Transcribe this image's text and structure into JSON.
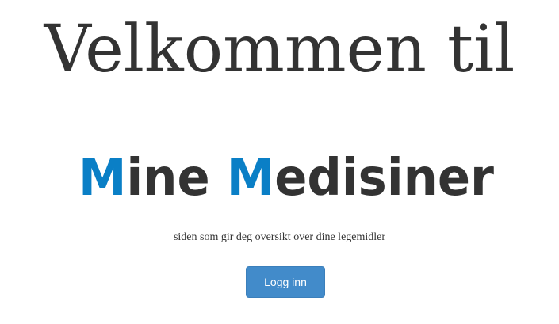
{
  "heading": {
    "title": "Velkommen til"
  },
  "logo": {
    "first_word_initial": "M",
    "first_word_rest": "ine ",
    "second_word_initial": "M",
    "second_word_rest": "edisiner",
    "initial_color": "#0a7fc6",
    "text_color": "#333333"
  },
  "tagline": {
    "text": "siden som gir deg oversikt over dine legemidler"
  },
  "login": {
    "label": "Logg inn",
    "color": "#428bca"
  }
}
